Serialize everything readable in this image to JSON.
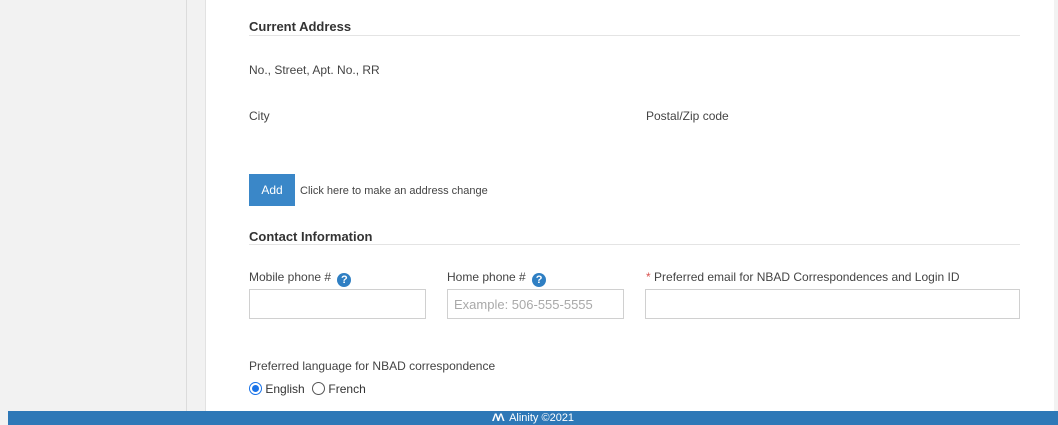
{
  "current_address": {
    "title": "Current Address",
    "street_label": "No., Street, Apt. No., RR",
    "city_label": "City",
    "postal_label": "Postal/Zip code",
    "add_button_label": "Add",
    "add_hint": "Click here to make an address change"
  },
  "contact": {
    "title": "Contact Information",
    "mobile_label": "Mobile phone #",
    "mobile_value": "",
    "home_label": "Home phone #",
    "home_placeholder": "Example: 506-555-5555",
    "email_required_mark": "*",
    "email_label": "Preferred email for NBAD Correspondences and Login ID",
    "email_value": "",
    "help_icon_glyph": "?"
  },
  "language": {
    "label": "Preferred language for NBAD correspondence",
    "options": [
      {
        "label": "English",
        "selected": true
      },
      {
        "label": "French",
        "selected": false
      }
    ]
  },
  "footer": {
    "logo_glyph": "ΛΛ",
    "text": "Alinity ©2021"
  },
  "colors": {
    "accent": "#3a87c8",
    "footer": "#2e78b7",
    "required": "#d9534f"
  }
}
